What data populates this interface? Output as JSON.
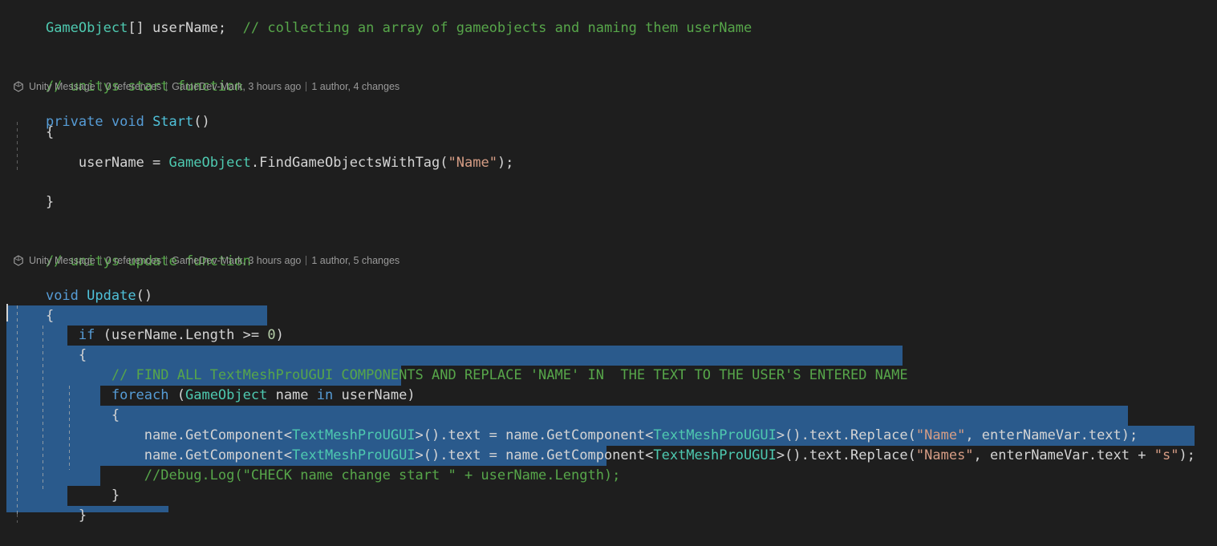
{
  "editor": {
    "background": "#1e1e1e",
    "selection_color": "#2a5a8c",
    "caret_color": "#d4d4d4",
    "font_size_px": 17
  },
  "colors": {
    "comment": "#57a64a",
    "keyword": "#569cd6",
    "type": "#4ec9b0",
    "method": "#4fc1d9",
    "string": "#d69d85",
    "plain": "#d4d4d4",
    "number": "#b5cea8",
    "codelens_text": "#9a9a9a"
  },
  "codelens": [
    {
      "icon": "unity-cube-icon",
      "scope": "Unity Message",
      "references": "0 references",
      "author_change": "GameDev-Mark, 3 hours ago",
      "history": "1 author, 4 changes"
    },
    {
      "icon": "unity-cube-icon",
      "scope": "Unity Message",
      "references": "0 references",
      "author_change": "GameDev-Mark, 3 hours ago",
      "history": "1 author, 5 changes"
    }
  ],
  "code": {
    "line_field_decl": {
      "type": "GameObject",
      "brackets": "[]",
      "name": " userName;",
      "comment": "// collecting an array of gameobjects and naming them userName"
    },
    "comment_start": "// unitys start function",
    "sig_start": {
      "kw1": "private",
      "kw2": "void",
      "name": "Start",
      "parens": "()"
    },
    "brace_open_start": "{",
    "line_find": {
      "ident": "userName",
      "eq": " = ",
      "type": "GameObject",
      "dot_method": ".FindGameObjectsWithTag(",
      "string": "\"Name\"",
      "tail": ");"
    },
    "brace_close_start": "}",
    "comment_update": "// unitys update function",
    "sig_update": {
      "kw1": "void",
      "name": "Update",
      "parens": "()"
    },
    "brace_open_update": "{",
    "line_if": {
      "kw": "if",
      "cond": " (userName.Length >= ",
      "num": "0",
      "close": ")"
    },
    "brace_open_if": "{",
    "comment_find_all": "// FIND ALL TextMeshProUGUI COMPONENTS AND REPLACE 'NAME' IN  THE TEXT TO THE USER'S ENTERED NAME",
    "line_foreach": {
      "kw": "foreach",
      "open": " (",
      "type": "GameObject",
      "var": " name ",
      "in": "in",
      "coll": " userName)"
    },
    "brace_open_foreach": "{",
    "line_replace_1": {
      "p1": "name.GetComponent<",
      "t1": "TextMeshProUGUI",
      "p2": ">().text = name.GetComponent<",
      "t2": "TextMeshProUGUI",
      "p3": ">().text.Replace(",
      "s1": "\"Name\"",
      "p4": ", enterNameVar.text);"
    },
    "line_replace_2": {
      "p1": "name.GetComponent<",
      "t1": "TextMeshProUGUI",
      "p2": ">().text = name.GetComponent<",
      "t2": "TextMeshProUGUI",
      "p3": ">().text.Replace(",
      "s1": "\"Names\"",
      "p4": ", enterNameVar.text + ",
      "s2": "\"s\"",
      "p5": ");"
    },
    "comment_debug": "//Debug.Log(\"CHECK name change start \" + userName.Length);",
    "brace_close_foreach": "}",
    "brace_close_if": "}"
  }
}
